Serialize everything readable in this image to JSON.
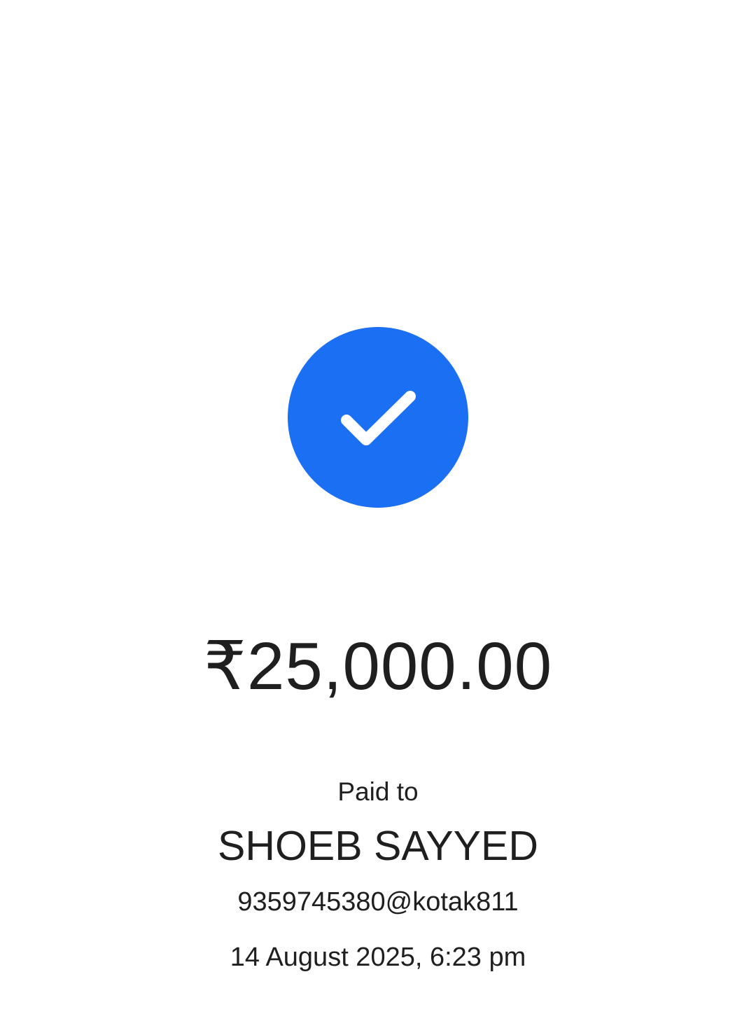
{
  "status": {
    "icon": "check-icon",
    "accent_color": "#1b6ff2"
  },
  "payment": {
    "amount": "₹25,000.00",
    "paid_to_label": "Paid to",
    "payee_name": "SHOEB SAYYED",
    "upi_id": "9359745380@kotak811",
    "timestamp": "14 August 2025, 6:23 pm"
  }
}
